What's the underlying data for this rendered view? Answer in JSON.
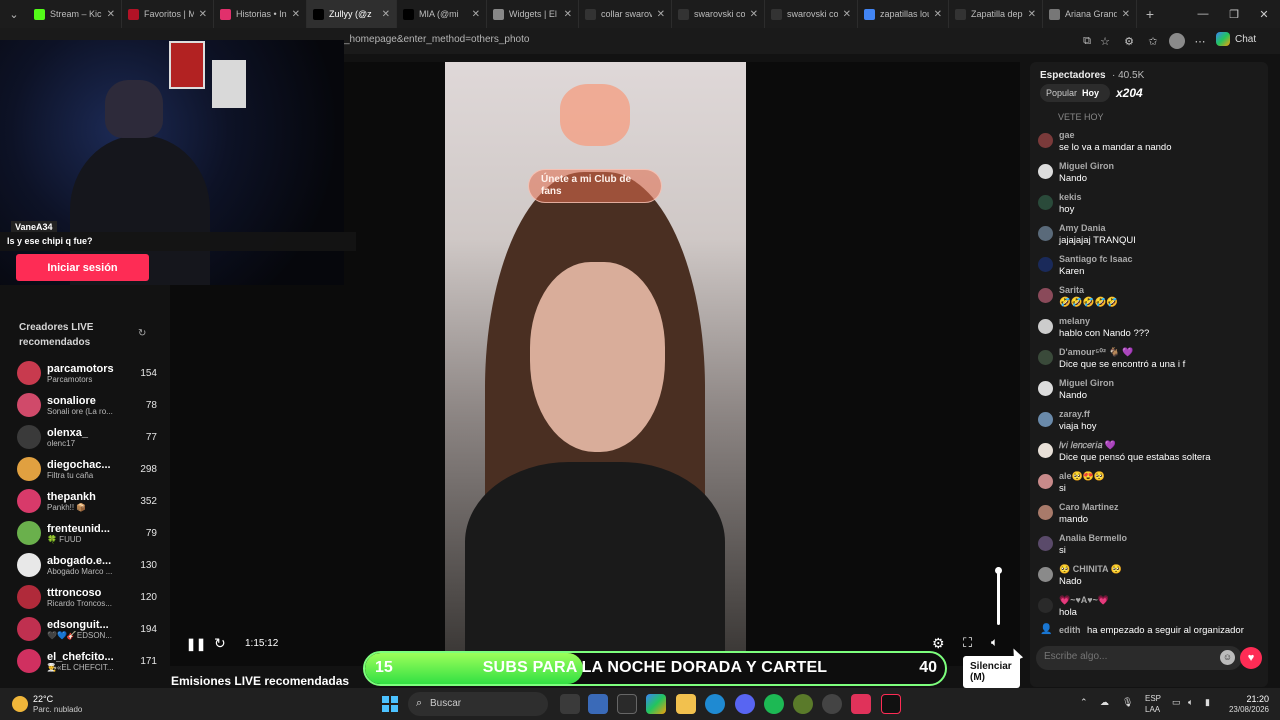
{
  "browser": {
    "tabs": [
      {
        "label": "Stream – Kick I",
        "icon": "kick-icon",
        "color": "#53fc18",
        "active": false
      },
      {
        "label": "Favoritos | My",
        "icon": "favorites-icon",
        "color": "#b11226",
        "active": false
      },
      {
        "label": "Historias • Insta",
        "icon": "instagram-icon",
        "color": "#e1306c",
        "active": false
      },
      {
        "label": "Zullyy (@z",
        "icon": "tiktok-icon",
        "color": "#000000",
        "active": true
      },
      {
        "label": "MIA (@mi",
        "icon": "tiktok-icon",
        "color": "#000000",
        "active": false
      },
      {
        "label": "Widgets | El m",
        "icon": "widgets-icon",
        "color": "#888888",
        "active": false
      },
      {
        "label": "collar swarovsk",
        "icon": "shop-icon",
        "color": "#333333",
        "active": false
      },
      {
        "label": "swarovski colla",
        "icon": "shop-icon",
        "color": "#333333",
        "active": false
      },
      {
        "label": "swarovski colla",
        "icon": "shop-icon",
        "color": "#333333",
        "active": false
      },
      {
        "label": "zapatillas louis",
        "icon": "search-icon",
        "color": "#4285f4",
        "active": false
      },
      {
        "label": "Zapatilla depo",
        "icon": "shop-icon",
        "color": "#333333",
        "active": false
      },
      {
        "label": "Ariana Grande",
        "icon": "globe-icon",
        "color": "#777777",
        "active": false
      }
    ],
    "url": "_homepage&enter_method=others_photo",
    "copilot_label": "Chat"
  },
  "webcam": {
    "username": "VaneA34",
    "message": "Is y ese chipi q fue?"
  },
  "sidebar": {
    "login_label": "Iniciar sesión",
    "creators_title": "Creadores LIVE recomendados",
    "creators": [
      {
        "name": "parcamotors",
        "sub": "Parcamotors",
        "count": "154",
        "color": "#c83a4e"
      },
      {
        "name": "sonaliore",
        "sub": "Sonali ore (La ro...",
        "count": "78",
        "color": "#d04a6a"
      },
      {
        "name": "olenxa_",
        "sub": "olenc17",
        "count": "77",
        "color": "#3a3a3a"
      },
      {
        "name": "diegochac...",
        "sub": "Filtra tu caña",
        "count": "298",
        "color": "#e0a040"
      },
      {
        "name": "thepankh",
        "sub": "Pankh!! 📦",
        "count": "352",
        "color": "#d83a6a"
      },
      {
        "name": "frenteunid...",
        "sub": "🍀 FUUD",
        "count": "79",
        "color": "#6ab04c"
      },
      {
        "name": "abogado.e...",
        "sub": "Abogado Marco ...",
        "count": "130",
        "color": "#e8e8e8"
      },
      {
        "name": "tttroncoso",
        "sub": "Ricardo Troncos...",
        "count": "120",
        "color": "#b02a3a"
      },
      {
        "name": "edsonguit...",
        "sub": "🖤💙🎸EDSON...",
        "count": "194",
        "color": "#c03050"
      },
      {
        "name": "el_chefcito...",
        "sub": "👨‍🍳«EL CHEFCIT...",
        "count": "171",
        "color": "#d03060"
      }
    ]
  },
  "video": {
    "filter_banner": "Únete a mi Club de fans",
    "timecode": "1:15:12",
    "tooltip": "Silenciar (M)",
    "volume_level": 1.0
  },
  "overlay": {
    "left_number": "15",
    "text": "SUBS PARA LA NOCHE DORADA Y CARTEL",
    "right_number": "40",
    "progress": 0.375
  },
  "section_title": "Emisiones LIVE recomendadas",
  "chat": {
    "viewers_label": "Espectadores",
    "viewers_count": "· 40.5K",
    "filter_popular": "Popular",
    "filter_today": "Hoy",
    "multiplier": "x204",
    "faded_message": "VETE HOY",
    "messages": [
      {
        "user": "gae",
        "text": "se lo va a mandar a nando",
        "color": "#7a3a3a"
      },
      {
        "user": "Miguel Giron",
        "text": "Nando",
        "color": "#dcdcdc"
      },
      {
        "user": "kekis",
        "text": "hoy",
        "color": "#2a4a3a"
      },
      {
        "user": "Amy Dania",
        "text": "jajajajaj TRANQUI",
        "color": "#5a6a7a"
      },
      {
        "user": "Santiago fc Isaac",
        "text": "Karen",
        "color": "#1a2a5a"
      },
      {
        "user": "Sarita",
        "text": "🤣🤣🤣🤣🤣",
        "color": "#8a4a5a"
      },
      {
        "user": "melany",
        "text": "hablo con Nando ???",
        "color": "#cccccc"
      },
      {
        "user": "D'amour⁵⁰² 🐐 💜",
        "text": "Dice que se encontró a una i f",
        "color": "#3a4a3a"
      },
      {
        "user": "Miguel Giron",
        "text": "Nando",
        "color": "#dcdcdc"
      },
      {
        "user": "zaray.ff",
        "text": "viaja hoy",
        "color": "#6a8aaa"
      },
      {
        "user": "𝐼𝑣𝑖 𝑙𝑒𝑛𝑐𝑒𝑟𝑖𝑎 💜",
        "text": "Dice que pensó que estabas soltera",
        "color": "#e8e0d8"
      },
      {
        "user": "ale🥺😍🥺",
        "text": "si",
        "color": "#c88a8a"
      },
      {
        "user": "Caro Martinez",
        "text": "mando",
        "color": "#a87a6a"
      },
      {
        "user": "Analia Bermello",
        "text": "si",
        "color": "#5a4a6a"
      },
      {
        "user": "🥺 CHINITA 🥺",
        "text": "Nado",
        "color": "#8a8a8a"
      },
      {
        "user": "💗~♥A♥~💗",
        "text": "hola",
        "color": "#2a2a2a"
      }
    ],
    "join_user": "edith",
    "join_text": "ha empezado a seguir al organizador",
    "input_placeholder": "Escribe algo..."
  },
  "taskbar": {
    "temperature": "22°C",
    "weather": "Parc. nublado",
    "search_label": "Buscar",
    "lang_top": "ESP",
    "lang_bottom": "LAA",
    "time": "21:20",
    "date": "23/08/2026"
  }
}
